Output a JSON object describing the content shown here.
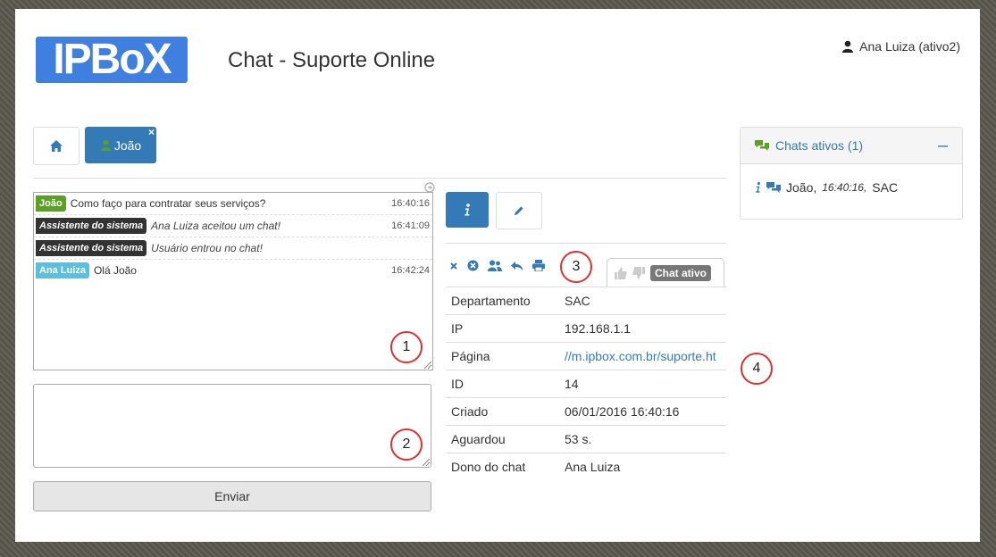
{
  "header": {
    "logo_text": "IPBoX",
    "title": "Chat - Suporte Online",
    "user": "Ana Luiza (ativo2)"
  },
  "tabs": {
    "active_chat_label": "João",
    "close_label": "×"
  },
  "chat_log": [
    {
      "sender": "João",
      "text": "Como faço para contratar seus serviços?",
      "time": "16:40:16"
    },
    {
      "sender": "Assistente do sistema",
      "text": "Ana Luiza aceitou um chat!",
      "time": "16:41:09"
    },
    {
      "sender": "Assistente do sistema",
      "text": "Usuário entrou no chat!",
      "time": ""
    },
    {
      "sender": "Ana Luiza",
      "text": "Olá João",
      "time": "16:42:24"
    }
  ],
  "composer": {
    "send_label": "Enviar"
  },
  "annotations": [
    "1",
    "2",
    "3",
    "4"
  ],
  "status": {
    "label": "Chat ativo"
  },
  "details": [
    {
      "label": "Departamento",
      "value": "SAC"
    },
    {
      "label": "IP",
      "value": "192.168.1.1"
    },
    {
      "label": "Página",
      "value": "//m.ipbox.com.br/suporte.ht"
    },
    {
      "label": "ID",
      "value": "14"
    },
    {
      "label": "Criado",
      "value": "06/01/2016 16:40:16"
    },
    {
      "label": "Aguardou",
      "value": "53 s."
    },
    {
      "label": "Dono do chat",
      "value": "Ana Luiza"
    }
  ],
  "active_chats": {
    "title": "Chats ativos (1)",
    "collapse": "–",
    "items": [
      {
        "name": "João,",
        "time": "16:40:16,",
        "department": "SAC"
      }
    ]
  },
  "colors": {
    "primary": "#337ab7",
    "logo": "#3f7fe0",
    "user_badge": "#5aa024",
    "system_badge": "#333333",
    "agent_badge": "#5bc0de",
    "annotation": "#e03030"
  }
}
